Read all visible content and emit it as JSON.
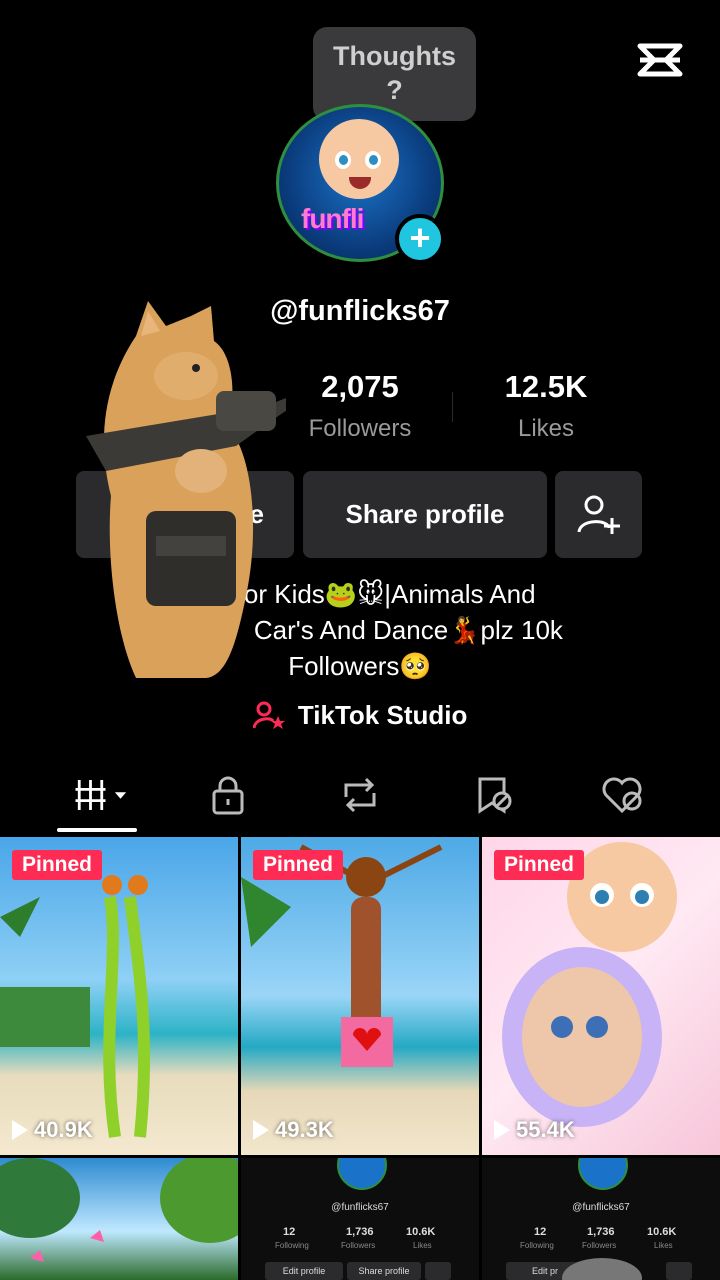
{
  "tooltip": {
    "text": "Thoughts\n?"
  },
  "profile": {
    "username": "@funflicks67",
    "avatar_text": "funfli",
    "stats": [
      {
        "value": "2,075",
        "label": "Followers"
      },
      {
        "value": "12.5K",
        "label": "Likes"
      }
    ],
    "buttons": {
      "edit_label": "le",
      "share_label": "Share profile"
    },
    "bio_line1": "For Kids🐸🐭|Animals And",
    "bio_line2": "E           Car's And Dance💃plz 10k",
    "bio_line3": "Followers🥺",
    "studio_label": "TikTok Studio"
  },
  "tabs": [
    "videos-grid",
    "private",
    "reposts",
    "favorites",
    "liked"
  ],
  "grid": [
    {
      "pinned": "Pinned",
      "views": "40.9K"
    },
    {
      "pinned": "Pinned",
      "views": "49.3K"
    },
    {
      "pinned": "Pinned",
      "views": "55.4K"
    }
  ],
  "mini_profile": {
    "username": "@funflicks67",
    "following": "12",
    "following_label": "Following",
    "followers": "1,736",
    "followers_label": "Followers",
    "likes": "10.6K",
    "likes_label": "Likes",
    "edit_label": "Edit profile",
    "edit_label_cut": "Edit pr",
    "share_label": "Share profile"
  },
  "colors": {
    "accent": "#fe2c55",
    "badge": "#20c5e0",
    "button_bg": "#2b2b2d"
  }
}
